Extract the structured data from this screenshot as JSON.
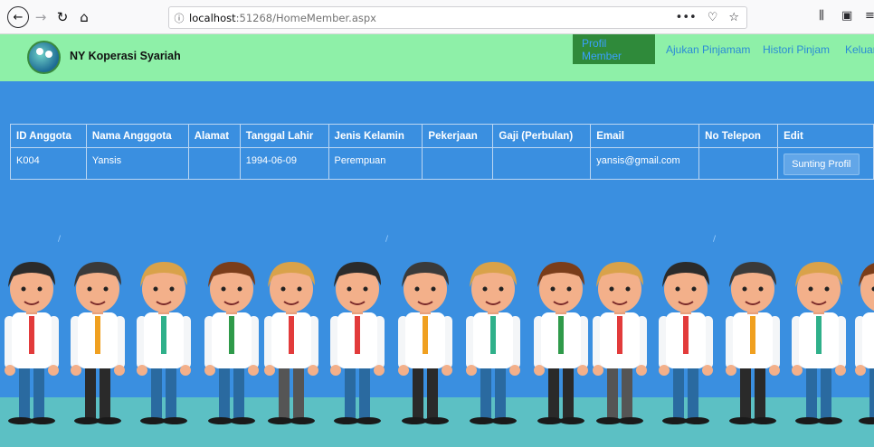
{
  "browser": {
    "url_host": "localhost",
    "url_path": ":51268/HomeMember.aspx",
    "url_info_icon": "info-icon",
    "page_actions": "•••"
  },
  "header": {
    "brand": "NY Koperasi Syariah",
    "menu": [
      "Profil Member",
      "Ajukan Pinjamam",
      "Histori Pinjam",
      "Keluar"
    ]
  },
  "table": {
    "columns": [
      "ID Anggota",
      "Nama Angggota",
      "Alamat",
      "Tanggal Lahir",
      "Jenis Kelamin",
      "Pekerjaan",
      "Gaji (Perbulan)",
      "Email",
      "No Telepon",
      "Edit"
    ],
    "rows": [
      {
        "id": "K004",
        "nama": "Yansis",
        "alamat": "",
        "tanggal_lahir": "1994-06-09",
        "jenis_kelamin": "Perempuan",
        "pekerjaan": "",
        "gaji": "",
        "email": "yansis@gmail.com",
        "telepon": "",
        "edit_label": "Sunting Profil"
      }
    ]
  },
  "colors": {
    "header_bg": "#8ef0a8",
    "page_bg": "#3a8fe0",
    "active_menu_bg": "#2f8a3a",
    "floor": "#5cc0c4"
  }
}
